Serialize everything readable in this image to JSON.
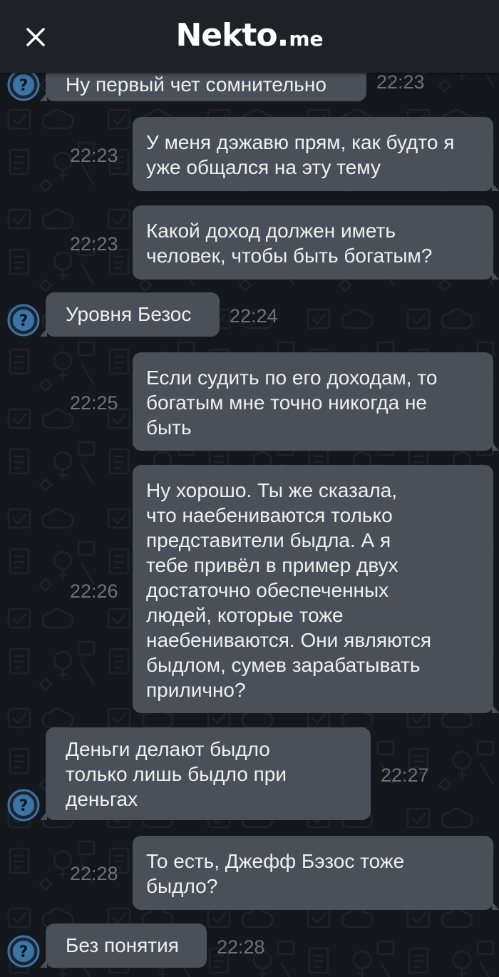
{
  "header": {
    "close_icon": "close-icon",
    "logo_main": "Nekto",
    "logo_dot": ".",
    "logo_sub": "me"
  },
  "colors": {
    "background": "#14171b",
    "header": "#1e2227",
    "bubble": "#4a5058",
    "text": "#eef0f2",
    "time": "#6d737b",
    "avatar": "#3d74a6"
  },
  "messages": [
    {
      "side": "in",
      "text": "Ну первый чет сомнительно",
      "time": "22:23",
      "avatar_icon": "question-avatar-icon"
    },
    {
      "side": "out",
      "text": "У меня дэжавю прям, как будто я\nуже общался на эту тему",
      "time": "22:23"
    },
    {
      "side": "out",
      "text": "Какой доход должен иметь\nчеловек, чтобы быть богатым?",
      "time": "22:23"
    },
    {
      "side": "in",
      "text": "Уровня Безос",
      "time": "22:24",
      "avatar_icon": "question-avatar-icon"
    },
    {
      "side": "out",
      "text": "Если судить по его доходам, то\nбогатым мне точно никогда не\nбыть",
      "time": "22:25"
    },
    {
      "side": "out",
      "text": "Ну хорошо. Ты же сказала,\nчто наебениваются только\nпредставители быдла. А я\nтебе привёл в пример двух\nдостаточно обеспеченных\nлюдей, которые тоже\nнаебениваются. Они являются\nбыдлом, сумев зарабатывать\nприлично?",
      "time": "22:26"
    },
    {
      "side": "in",
      "text": "Деньги делают быдло\nтолько лишь быдло при\nденьгах",
      "time": "22:27",
      "avatar_icon": "question-avatar-icon"
    },
    {
      "side": "out",
      "text": "То есть, Джефф Бэзос тоже\nбыдло?",
      "time": "22:28"
    },
    {
      "side": "in",
      "text": "Без понятия",
      "time": "22:28",
      "avatar_icon": "question-avatar-icon"
    }
  ]
}
